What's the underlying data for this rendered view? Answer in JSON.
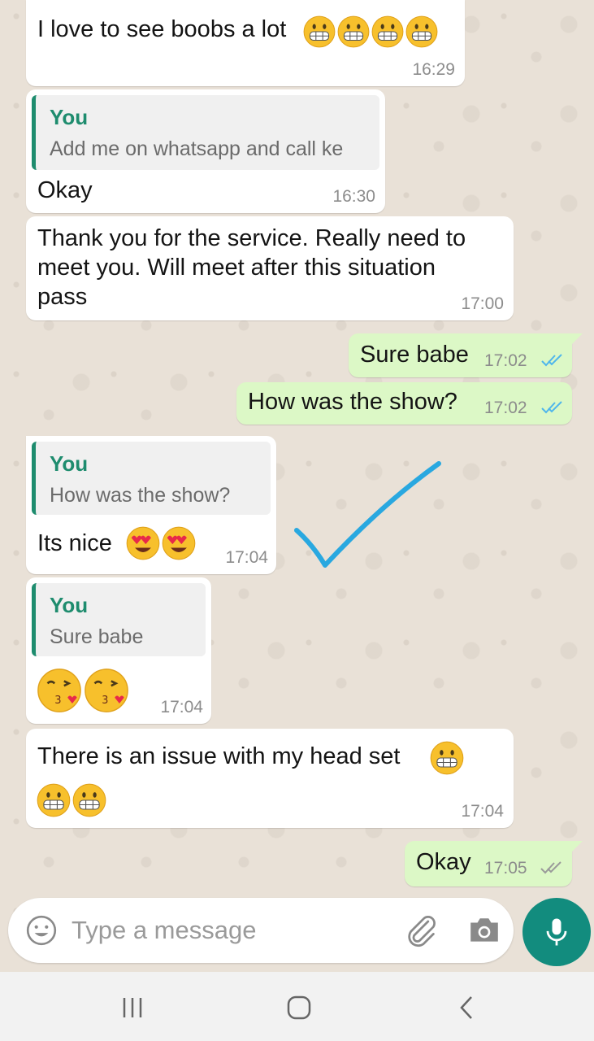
{
  "messages": [
    {
      "direction": "in",
      "text": "I love to see boobs a lot",
      "emojis": [
        "grimacing",
        "grimacing",
        "grimacing",
        "grimacing"
      ],
      "time": "16:29"
    },
    {
      "direction": "in",
      "quote": {
        "author": "You",
        "text": "Add me on whatsapp and call ke"
      },
      "text": "Okay",
      "time": "16:30"
    },
    {
      "direction": "in",
      "lines": [
        "Thank you for the service. Really need to",
        "meet you.  Will meet after this situation",
        "pass"
      ],
      "time": "17:00"
    },
    {
      "direction": "out",
      "text": "Sure babe",
      "time": "17:02",
      "status": "read"
    },
    {
      "direction": "out",
      "text": "How was the show?",
      "time": "17:02",
      "status": "read"
    },
    {
      "direction": "in",
      "quote": {
        "author": "You",
        "text": "How was the show?"
      },
      "text": "Its nice",
      "emojis": [
        "heart-eyes",
        "heart-eyes"
      ],
      "time": "17:04"
    },
    {
      "direction": "in",
      "quote": {
        "author": "You",
        "text": "Sure babe"
      },
      "emojis": [
        "kissing-heart",
        "kissing-heart"
      ],
      "time": "17:04"
    },
    {
      "direction": "in",
      "text": "There is an issue with my head set",
      "emojis": [
        "grimacing",
        "grimacing",
        "grimacing"
      ],
      "time": "17:04"
    },
    {
      "direction": "out",
      "text": "Okay",
      "time": "17:05",
      "status": "delivered"
    }
  ],
  "input": {
    "placeholder": "Type a message"
  },
  "icons": {
    "emoji": "smiley-icon",
    "attach": "paperclip-icon",
    "camera": "camera-icon",
    "mic": "microphone-icon",
    "nav_recent": "recent-apps-icon",
    "nav_home": "home-icon",
    "nav_back": "back-icon"
  },
  "colors": {
    "incoming_bubble": "#ffffff",
    "outgoing_bubble": "#dcf8c6",
    "quote_accent": "#1e8c6e",
    "mic_button": "#128c7e",
    "read_ticks": "#4fb6ec",
    "annotation_check": "#29a8e0"
  }
}
